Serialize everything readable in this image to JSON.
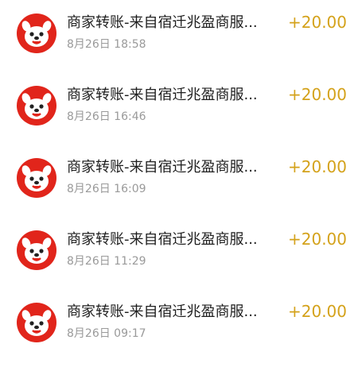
{
  "transactions": [
    {
      "title": "商家转账-来自宿迁兆盈商服...",
      "time": "8月26日 18:58",
      "amount": "+20.00",
      "icon": "jd-joy-dog-icon"
    },
    {
      "title": "商家转账-来自宿迁兆盈商服...",
      "time": "8月26日 16:46",
      "amount": "+20.00",
      "icon": "jd-joy-dog-icon"
    },
    {
      "title": "商家转账-来自宿迁兆盈商服...",
      "time": "8月26日 16:09",
      "amount": "+20.00",
      "icon": "jd-joy-dog-icon"
    },
    {
      "title": "商家转账-来自宿迁兆盈商服...",
      "time": "8月26日 11:29",
      "amount": "+20.00",
      "icon": "jd-joy-dog-icon"
    },
    {
      "title": "商家转账-来自宿迁兆盈商服...",
      "time": "8月26日 09:17",
      "amount": "+20.00",
      "icon": "jd-joy-dog-icon"
    }
  ],
  "colors": {
    "avatar_bg": "#e1251b",
    "amount": "#d4a21b",
    "title": "#1e1e1e",
    "time": "#9a9a9a"
  }
}
